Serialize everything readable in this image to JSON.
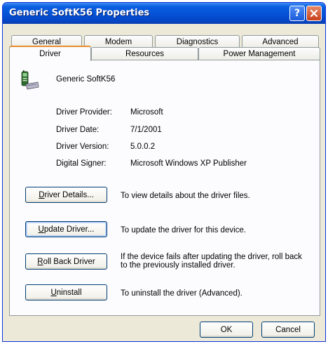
{
  "window": {
    "title": "Generic SoftK56 Properties",
    "help_glyph": "?"
  },
  "tabs": {
    "row1": [
      "General",
      "Modem",
      "Diagnostics",
      "Advanced"
    ],
    "row2": [
      "Driver",
      "Resources",
      "Power Management"
    ],
    "active": "Driver"
  },
  "device": {
    "name": "Generic SoftK56",
    "icon": "modem-phone-icon"
  },
  "info": [
    {
      "label": "Driver Provider:",
      "value": "Microsoft"
    },
    {
      "label": "Driver Date:",
      "value": "7/1/2001"
    },
    {
      "label": "Driver Version:",
      "value": "5.0.0.2"
    },
    {
      "label": "Digital Signer:",
      "value": "Microsoft Windows XP Publisher"
    }
  ],
  "actions": [
    {
      "key": "D",
      "rest": "river Details...",
      "description": "To view details about the driver files."
    },
    {
      "key": "U",
      "rest": "pdate Driver...",
      "description": "To update the driver for this device."
    },
    {
      "key": "R",
      "rest": "oll Back Driver",
      "description": "If the device fails after updating the driver, roll back to the previously installed driver."
    },
    {
      "key": "U",
      "rest": "ninstall",
      "description": "To uninstall the driver (Advanced)."
    }
  ],
  "footer": {
    "ok": "OK",
    "cancel": "Cancel"
  },
  "colors": {
    "title_bar": "#0554d8",
    "active_tab_accent": "#e68b2c",
    "button_border": "#003c74",
    "dialog_bg": "#ece9d8"
  }
}
